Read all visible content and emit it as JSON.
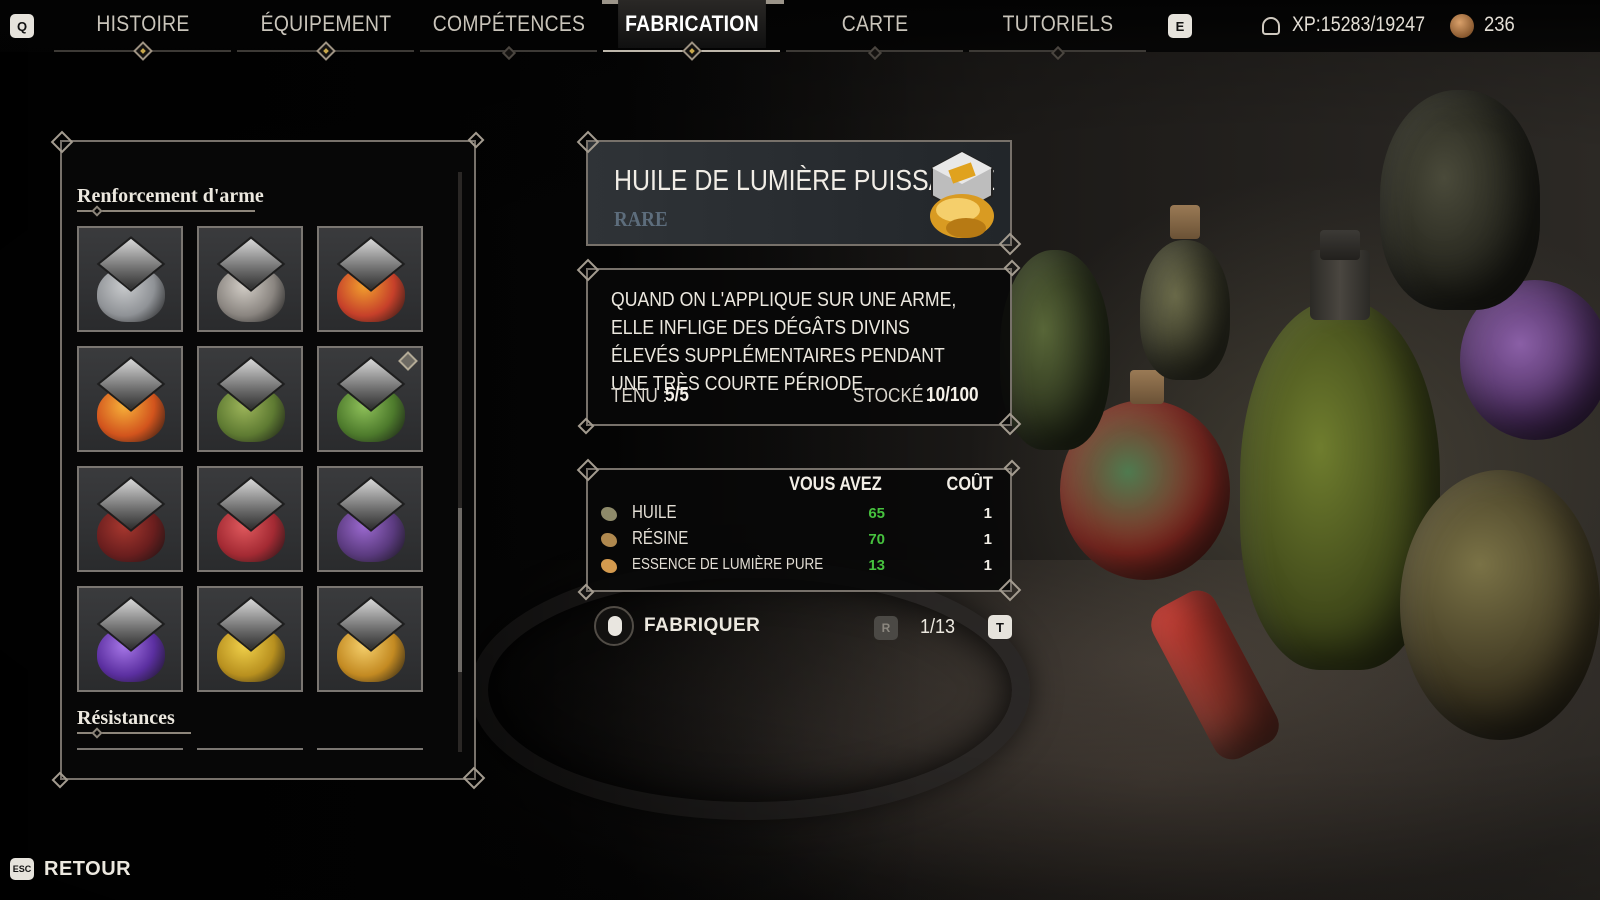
{
  "nav": {
    "prev_key": "Q",
    "next_key": "E",
    "tabs": [
      {
        "label": "HISTOIRE"
      },
      {
        "label": "ÉQUIPEMENT"
      },
      {
        "label": "COMPÉTENCES"
      },
      {
        "label": "FABRICATION"
      },
      {
        "label": "CARTE"
      },
      {
        "label": "TUTORIELS"
      }
    ],
    "active_tab": "FABRICATION",
    "xp": "XP:15283/19247",
    "coins": "236"
  },
  "recipes": {
    "section_1": "Renforcement d'arme",
    "section_2": "Résistances",
    "items": [
      {
        "color": "#8f9296",
        "accent": "#c9cbcd",
        "new": false
      },
      {
        "color": "#8a8580",
        "accent": "#d2cdc6",
        "new": false
      },
      {
        "color": "#c6402a",
        "accent": "#f2a02e",
        "new": false
      },
      {
        "color": "#d2541d",
        "accent": "#f7b13a",
        "new": false
      },
      {
        "color": "#5e7a32",
        "accent": "#9db55a",
        "new": false
      },
      {
        "color": "#4d7a2c",
        "accent": "#8fc15a",
        "new": true
      },
      {
        "color": "#6a1e1e",
        "accent": "#a8382f",
        "new": false
      },
      {
        "color": "#a32a33",
        "accent": "#e05a5e",
        "new": false
      },
      {
        "color": "#5a3a7e",
        "accent": "#9c6ad0",
        "new": false
      },
      {
        "color": "#5b2fa0",
        "accent": "#a777e8",
        "new": false
      },
      {
        "color": "#b8901f",
        "accent": "#f0d04a",
        "new": false
      },
      {
        "color": "#c38a22",
        "accent": "#f5cf6b",
        "new": false
      }
    ]
  },
  "item": {
    "name": "HUILE DE LUMIÈRE PUISSANTE",
    "rarity": "RARE",
    "description": "QUAND ON L'APPLIQUE SUR UNE ARME, ELLE INFLIGE DES DÉGÂTS DIVINS ÉLEVÉS SUPPLÉMENTAIRES PENDANT UNE TRÈS COURTE PÉRIODE.",
    "held_label": "TENU :",
    "held_value": "5/5",
    "stock_label": "STOCKÉ :",
    "stock_value": "10/100"
  },
  "costs": {
    "have_header": "VOUS AVEZ",
    "cost_header": "COÛT",
    "ingredients": [
      {
        "name": "HUILE",
        "have": "65",
        "cost": "1",
        "icon": "oil-icon",
        "color": "#8e8a6a"
      },
      {
        "name": "RÉSINE",
        "have": "70",
        "cost": "1",
        "icon": "resin-icon",
        "color": "#b0894f"
      },
      {
        "name": "ESSENCE DE LUMIÈRE PURE",
        "have": "13",
        "cost": "1",
        "icon": "light-essence-icon",
        "color": "#d49a4e"
      }
    ]
  },
  "craft": {
    "label": "FABRIQUER",
    "decrease_key": "R",
    "increase_key": "T",
    "quantity": "1/13"
  },
  "back": {
    "key": "ESC",
    "label": "RETOUR"
  }
}
